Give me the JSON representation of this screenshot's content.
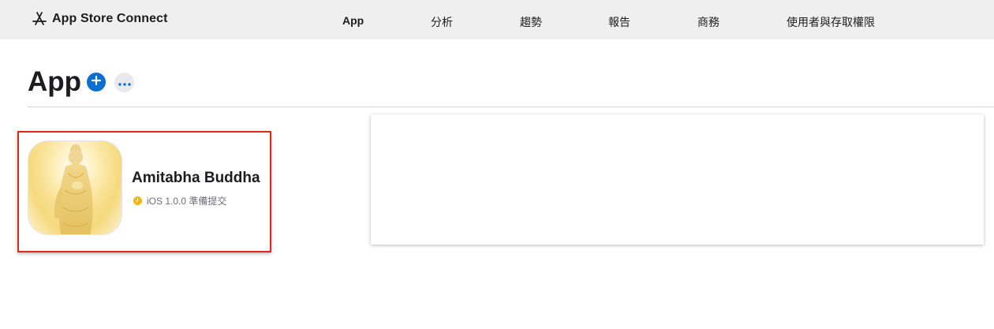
{
  "header": {
    "brand": "App Store Connect",
    "nav": [
      {
        "label": "App",
        "active": true
      },
      {
        "label": "分析",
        "active": false
      },
      {
        "label": "趨勢",
        "active": false
      },
      {
        "label": "報告",
        "active": false
      },
      {
        "label": "商務",
        "active": false
      },
      {
        "label": "使用者與存取權限",
        "active": false
      }
    ]
  },
  "page": {
    "title": "App",
    "add_icon": "plus-circle-icon",
    "more_icon": "ellipsis-icon"
  },
  "apps": [
    {
      "name": "Amitabha Buddha",
      "status": "iOS 1.0.0 準備提交",
      "status_color": "#f5b800",
      "icon": "amitabha-buddha-app-icon"
    }
  ],
  "colors": {
    "accent": "#0a6fd0",
    "highlight_border": "#e8231f",
    "topbar": "#efefef"
  }
}
